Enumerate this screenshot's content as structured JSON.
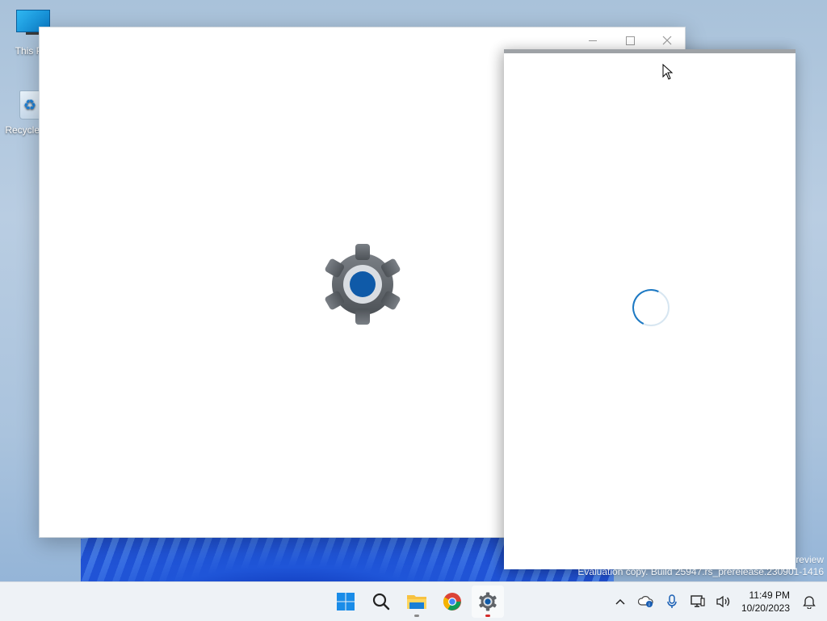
{
  "desktop": {
    "icons": [
      {
        "label": "This PC"
      },
      {
        "label": "Recycle Bin"
      }
    ]
  },
  "settings_window": {
    "controls": {
      "minimize": "minimize",
      "maximize": "maximize",
      "close": "close"
    },
    "splash_icon": "settings-gear-icon"
  },
  "loading_window": {
    "state": "loading",
    "icon": "loading-spinner-icon"
  },
  "watermark": {
    "line1": "review",
    "line2": "Evaluation copy. Build 25947.rs_prerelease.230901-1416"
  },
  "taskbar": {
    "apps": [
      {
        "name": "start-icon"
      },
      {
        "name": "search-icon"
      },
      {
        "name": "file-explorer-icon"
      },
      {
        "name": "chrome-icon"
      },
      {
        "name": "settings-icon"
      }
    ],
    "tray": {
      "time": "11:49 PM",
      "date": "10/20/2023"
    }
  },
  "colors": {
    "accent": "#1d79c3",
    "gear_body": "#5f6368",
    "gear_core": "#0f5aa8"
  }
}
